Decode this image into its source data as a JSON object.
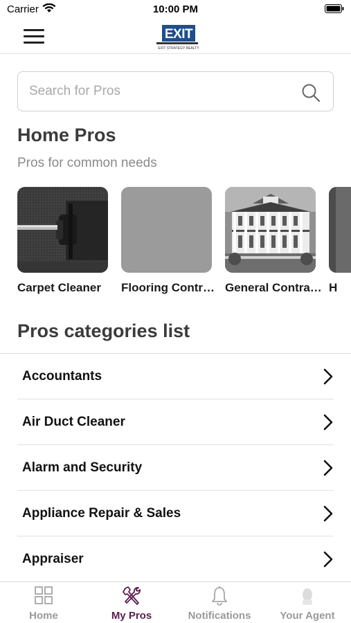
{
  "status_bar": {
    "carrier": "Carrier",
    "time": "10:00 PM"
  },
  "nav": {
    "logo_text": "EXIT",
    "logo_subtext": "EXIT STRATEGY REALTY"
  },
  "search": {
    "placeholder": "Search for Pros",
    "value": ""
  },
  "home_pros": {
    "title": "Home Pros",
    "subtitle": "Pros for common needs",
    "items": [
      {
        "label": "Carpet Cleaner",
        "image": "carpet-cleaner-photo"
      },
      {
        "label": "Flooring Contr…",
        "image": "placeholder-gray"
      },
      {
        "label": "General Contra…",
        "image": "house-photo"
      },
      {
        "label": "H",
        "image": "partial-photo"
      }
    ]
  },
  "categories": {
    "title": "Pros categories list",
    "items": [
      {
        "label": "Accountants"
      },
      {
        "label": "Air Duct Cleaner"
      },
      {
        "label": "Alarm and Security"
      },
      {
        "label": "Appliance Repair & Sales"
      },
      {
        "label": "Appraiser"
      }
    ]
  },
  "tab_bar": {
    "tabs": [
      {
        "label": "Home",
        "icon": "grid-icon",
        "active": false
      },
      {
        "label": "My Pros",
        "icon": "tools-icon",
        "active": true
      },
      {
        "label": "Notifications",
        "icon": "bell-icon",
        "active": false
      },
      {
        "label": "Your Agent",
        "icon": "agent-avatar-icon",
        "active": false
      }
    ]
  },
  "colors": {
    "accent": "#5a1e4f",
    "inactive_tab": "#9a9a9a",
    "brand_blue": "#1f4e8c"
  }
}
